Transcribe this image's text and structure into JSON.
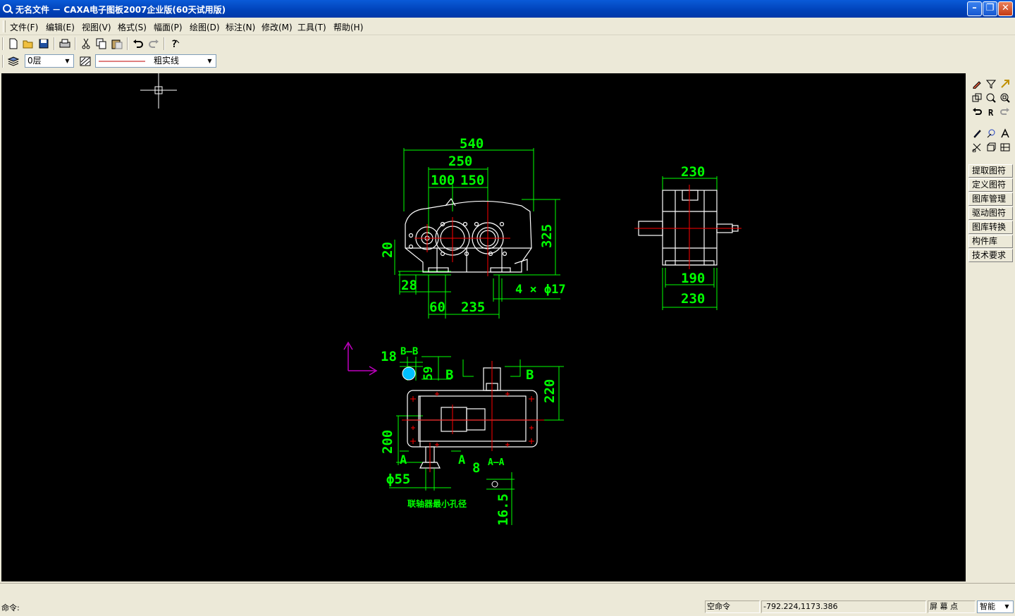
{
  "window": {
    "title": "无名文件 － CAXA电子图板2007企业版(60天试用版)",
    "min_glyph": "–",
    "restore_glyph": "❐",
    "close_glyph": "✕"
  },
  "menu": [
    "文件(F)",
    "编辑(E)",
    "视图(V)",
    "格式(S)",
    "幅面(P)",
    "绘图(D)",
    "标注(N)",
    "修改(M)",
    "工具(T)",
    "帮助(H)"
  ],
  "attributes": {
    "layer": "0层",
    "linetype": "粗实线"
  },
  "right_panel": {
    "library_buttons": [
      "提取图符",
      "定义图符",
      "图库管理",
      "驱动图符",
      "图库转换",
      "构件库",
      "技术要求"
    ]
  },
  "drawing": {
    "front_dims": {
      "d540": "540",
      "d250": "250",
      "d100": "100",
      "d150": "150",
      "d325": "325",
      "d20": "20",
      "d28": "28",
      "d60": "60",
      "d235": "235",
      "holes": "4 × ϕ17"
    },
    "side_dims": {
      "d230_top": "230",
      "d190": "190",
      "d230_bot": "230"
    },
    "top_dims": {
      "d18": "18",
      "sec_bb": "B—B",
      "d59": "59",
      "lbl_b1": "B",
      "lbl_b2": "B",
      "d220": "220",
      "d200": "200",
      "lbl_a1": "A",
      "lbl_a2": "A",
      "phi55": "ϕ55",
      "d8": "8",
      "sec_aa": "A—A",
      "d16_5": "16.5",
      "note": "联轴器最小孔径"
    }
  },
  "prompt": {
    "label": "命令:"
  },
  "status": {
    "command_state": "空命令",
    "coordinates": "-792.224,1173.386",
    "snap_label": "屏 幕 点",
    "snap_mode": "智能"
  },
  "colors": {
    "canvas_bg": "#000000",
    "dimension": "#00ff00",
    "outline": "#ffffff",
    "centerline": "#ff0000",
    "ucs": "#c000c0",
    "hatch": "#00c0ff"
  }
}
